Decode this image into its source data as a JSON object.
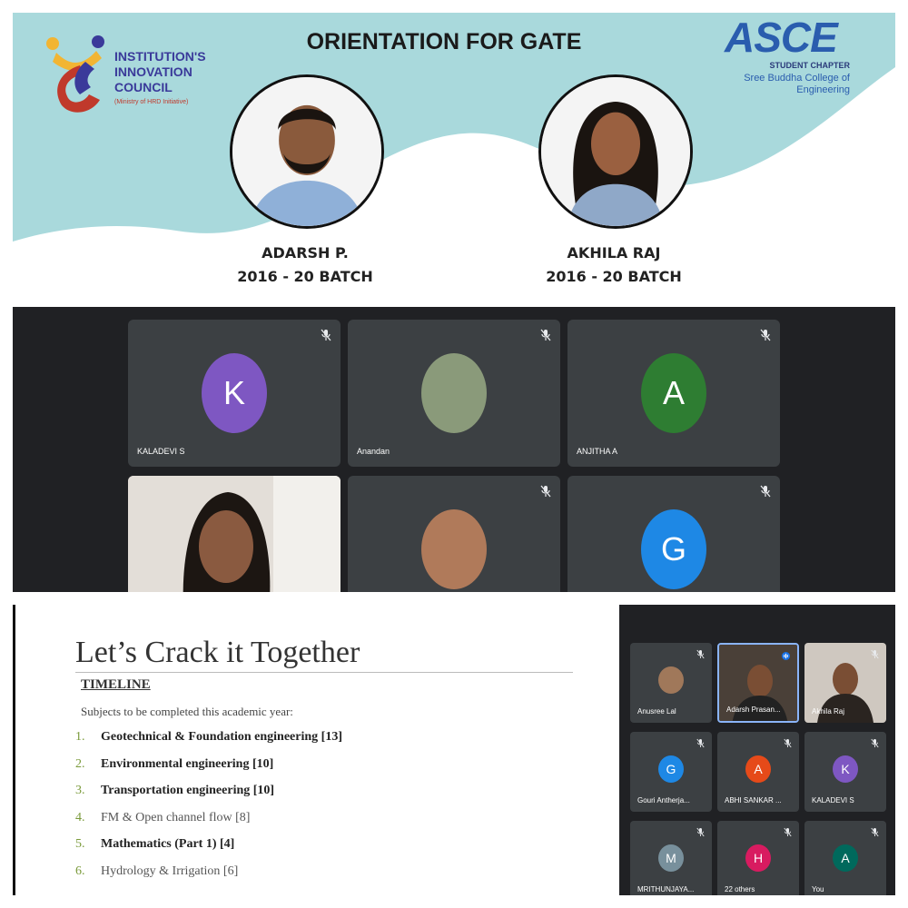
{
  "banner": {
    "title": "ORIENTATION FOR GATE",
    "iic": {
      "line1": "INSTITUTION'S",
      "line2": "INNOVATION",
      "line3": "COUNCIL",
      "sub": "(Ministry of HRD Initiative)"
    },
    "asce": {
      "logo": "ASCE",
      "chapter": "STUDENT CHAPTER",
      "college_line1": "Sree Buddha College of",
      "college_line2": "Engineering"
    },
    "speakers": [
      {
        "name": "ADARSH P.",
        "batch": "2016 - 20 BATCH"
      },
      {
        "name": "AKHILA RAJ",
        "batch": "2016 - 20 BATCH"
      }
    ]
  },
  "meet_grid": {
    "tiles": [
      {
        "name": "KALADEVI S",
        "initial": "K",
        "color": "#7e57c2",
        "type": "initial",
        "muted": true
      },
      {
        "name": "Anandan",
        "initial": "",
        "color": "#8a9a7a",
        "type": "photo",
        "muted": true
      },
      {
        "name": "ANJITHA A",
        "initial": "A",
        "color": "#2e7d32",
        "type": "initial",
        "muted": true
      },
      {
        "name": "",
        "initial": "",
        "color": "#5a5a5a",
        "type": "video",
        "muted": false
      },
      {
        "name": "",
        "initial": "",
        "color": "#b07a5a",
        "type": "photo",
        "muted": true
      },
      {
        "name": "",
        "initial": "G",
        "color": "#1e88e5",
        "type": "initial",
        "muted": true
      }
    ]
  },
  "slide": {
    "title": "Let’s Crack it Together",
    "section": "TIMELINE",
    "intro": "Subjects to be completed this academic year:",
    "items": [
      {
        "num": "1.",
        "text": "Geotechnical & Foundation engineering [13]",
        "style": "bold"
      },
      {
        "num": "2.",
        "text": "Environmental engineering [10]",
        "style": "bold"
      },
      {
        "num": "3.",
        "text": "Transportation engineering [10]",
        "style": "bold"
      },
      {
        "num": "4.",
        "text": "FM & Open channel flow [8]",
        "style": "light"
      },
      {
        "num": "5.",
        "text": "Mathematics (Part 1) [4]",
        "style": "bold"
      },
      {
        "num": "6.",
        "text": "Hydrology & Irrigation  [6]",
        "style": "light"
      }
    ]
  },
  "side_meet": {
    "tiles": [
      {
        "name": "Anusree Lal",
        "initial": "",
        "color": "#a0785a",
        "type": "photo",
        "muted": true,
        "active": false
      },
      {
        "name": "Adarsh Prasan...",
        "initial": "",
        "color": "#6a5a4a",
        "type": "video",
        "muted": false,
        "active": true
      },
      {
        "name": "Akhila Raj",
        "initial": "",
        "color": "#8a7a6a",
        "type": "video",
        "muted": true,
        "active": false
      },
      {
        "name": "Gouri Antherja...",
        "initial": "G",
        "color": "#1e88e5",
        "type": "initial",
        "muted": true,
        "active": false
      },
      {
        "name": "ABHI SANKAR ...",
        "initial": "A",
        "color": "#e64a19",
        "type": "initial",
        "muted": true,
        "active": false
      },
      {
        "name": "KALADEVI S",
        "initial": "K",
        "color": "#7e57c2",
        "type": "initial",
        "muted": true,
        "active": false
      },
      {
        "name": "MRITHUNJAYA...",
        "initial": "M",
        "color": "#78909c",
        "type": "initial",
        "muted": true,
        "active": false
      },
      {
        "name": "22 others",
        "initial": "H",
        "color": "#d81b60",
        "type": "others",
        "muted": true,
        "active": false
      },
      {
        "name": "You",
        "initial": "A",
        "color": "#00695c",
        "type": "initial",
        "muted": true,
        "active": false
      }
    ]
  },
  "colors": {
    "banner_wave": "#a9d9dc",
    "meet_bg": "#202124",
    "tile_bg": "#3c4043",
    "accent_blue": "#2a5dae"
  },
  "icons": [
    "mic-off-icon",
    "speaking-icon",
    "iic-logo-icon"
  ]
}
